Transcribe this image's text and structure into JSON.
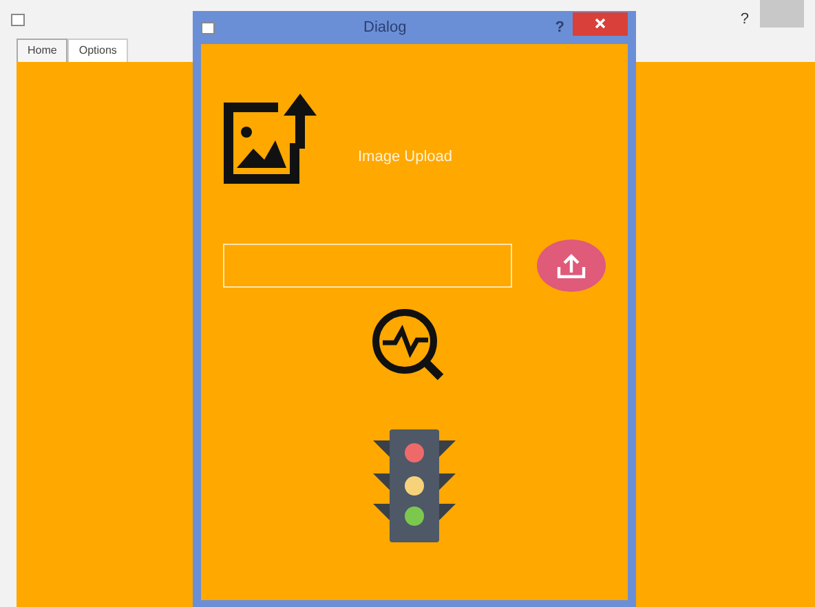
{
  "main_window": {
    "tabs": [
      {
        "label": "Home",
        "selected": true
      },
      {
        "label": "Options",
        "selected": false
      }
    ],
    "help_button": "?"
  },
  "dialog": {
    "title": "Dialog",
    "help_button": "?",
    "heading": "Image Upload"
  }
}
